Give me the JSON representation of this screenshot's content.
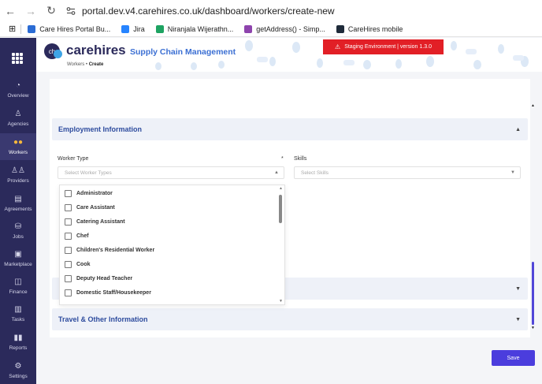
{
  "browser": {
    "url": "portal.dev.v4.carehires.co.uk/dashboard/workers/create-new",
    "bookmarks": [
      {
        "label": "Care Hires Portal Bu...",
        "color": "#2b6cd4"
      },
      {
        "label": "Jira",
        "color": "#2684ff"
      },
      {
        "label": "Niranjala Wijerathn...",
        "color": "#1ea362"
      },
      {
        "label": "getAddress() - Simp...",
        "color": "#8e44ad"
      },
      {
        "label": "CareHires mobile",
        "color": "#1f2b3a"
      }
    ]
  },
  "sidebar": {
    "items": [
      {
        "label": "Overview",
        "icon": "pie-chart-icon",
        "glyph": "◔"
      },
      {
        "label": "Agencies",
        "icon": "agency-icon",
        "glyph": "♙"
      },
      {
        "label": "Workers",
        "icon": "workers-icon",
        "glyph": "●●",
        "active": true
      },
      {
        "label": "Providers",
        "icon": "providers-icon",
        "glyph": "♙♙"
      },
      {
        "label": "Agreements",
        "icon": "agreement-icon",
        "glyph": "▤"
      },
      {
        "label": "Jobs",
        "icon": "jobs-icon",
        "glyph": "⛁"
      },
      {
        "label": "Marketplace",
        "icon": "marketplace-icon",
        "glyph": "▣"
      },
      {
        "label": "Finance",
        "icon": "finance-icon",
        "glyph": "◫"
      },
      {
        "label": "Tasks",
        "icon": "tasks-icon",
        "glyph": "▥"
      },
      {
        "label": "Reports",
        "icon": "reports-icon",
        "glyph": "▮▮"
      },
      {
        "label": "Settings",
        "icon": "settings-icon",
        "glyph": "⚙"
      }
    ]
  },
  "header": {
    "brand": "carehires",
    "subtitle": "Supply Chain Management",
    "breadcrumb_parent": "Workers",
    "breadcrumb_current": "Create",
    "staging_text": "Staging Environment | version 1.3.0"
  },
  "employment": {
    "title": "Employment Information",
    "worker_type_label": "Worker Type",
    "required_mark": "*",
    "worker_type_placeholder": "Select Worker Types",
    "skills_label": "Skills",
    "skills_placeholder": "Select Skills",
    "options": [
      "Administrator",
      "Care Assistant",
      "Catering Assistant",
      "Chef",
      "Children's Residential Worker",
      "Cook",
      "Deputy Head Teacher",
      "Domestic Staff/Housekeeper"
    ]
  },
  "travel": {
    "title": "Travel & Other Information"
  },
  "actions": {
    "save_label": "Save"
  },
  "colors": {
    "sidebar_bg": "#2b2a5b",
    "staging_red": "#e21f26",
    "primary": "#4b3ddd",
    "section_title": "#2e4c9e"
  }
}
